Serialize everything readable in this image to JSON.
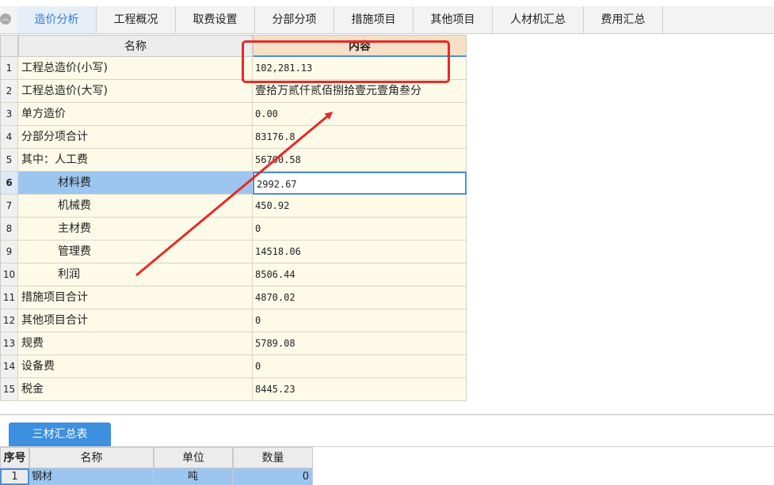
{
  "tabs": [
    {
      "label": "造价分析",
      "active": true
    },
    {
      "label": "工程概况",
      "active": false
    },
    {
      "label": "取费设置",
      "active": false
    },
    {
      "label": "分部分项",
      "active": false
    },
    {
      "label": "措施项目",
      "active": false
    },
    {
      "label": "其他项目",
      "active": false
    },
    {
      "label": "人材机汇总",
      "active": false
    },
    {
      "label": "费用汇总",
      "active": false
    }
  ],
  "collapse_icon": "chevron-up-icon",
  "summary_table": {
    "columns": [
      "名称",
      "内容"
    ],
    "rows": [
      {
        "no": "1",
        "name": "工程总造价(小写)",
        "value": "102,281.13"
      },
      {
        "no": "2",
        "name": "工程总造价(大写)",
        "value": "壹拾万贰仟贰佰捌拾壹元壹角叁分"
      },
      {
        "no": "3",
        "name": "单方造价",
        "value": "0.00"
      },
      {
        "no": "4",
        "name": "分部分项合计",
        "value": "83176.8"
      },
      {
        "no": "5",
        "name": "其中：人工费",
        "value": "56700.58"
      },
      {
        "no": "6",
        "name": "材料费",
        "value": "2992.67",
        "selected": true
      },
      {
        "no": "7",
        "name": "机械费",
        "value": "450.92"
      },
      {
        "no": "8",
        "name": "主材费",
        "value": "0"
      },
      {
        "no": "9",
        "name": "管理费",
        "value": "14518.06"
      },
      {
        "no": "10",
        "name": "利润",
        "value": "8506.44"
      },
      {
        "no": "11",
        "name": "措施项目合计",
        "value": "4870.02"
      },
      {
        "no": "12",
        "name": "其他项目合计",
        "value": "0"
      },
      {
        "no": "13",
        "name": "规费",
        "value": "5789.08"
      },
      {
        "no": "14",
        "name": "设备费",
        "value": "0"
      },
      {
        "no": "15",
        "name": "税金",
        "value": "8445.23"
      }
    ]
  },
  "bottom_tab": {
    "label": "三材汇总表"
  },
  "materials_table": {
    "columns": [
      "序号",
      "名称",
      "单位",
      "数量"
    ],
    "rows": [
      {
        "no": "1",
        "name": "钢材",
        "unit": "吨",
        "qty": "0"
      }
    ]
  },
  "colors": {
    "accent": "#4a90d9",
    "annotation": "#e52a2a",
    "tab_button": "#3d8fe0"
  }
}
